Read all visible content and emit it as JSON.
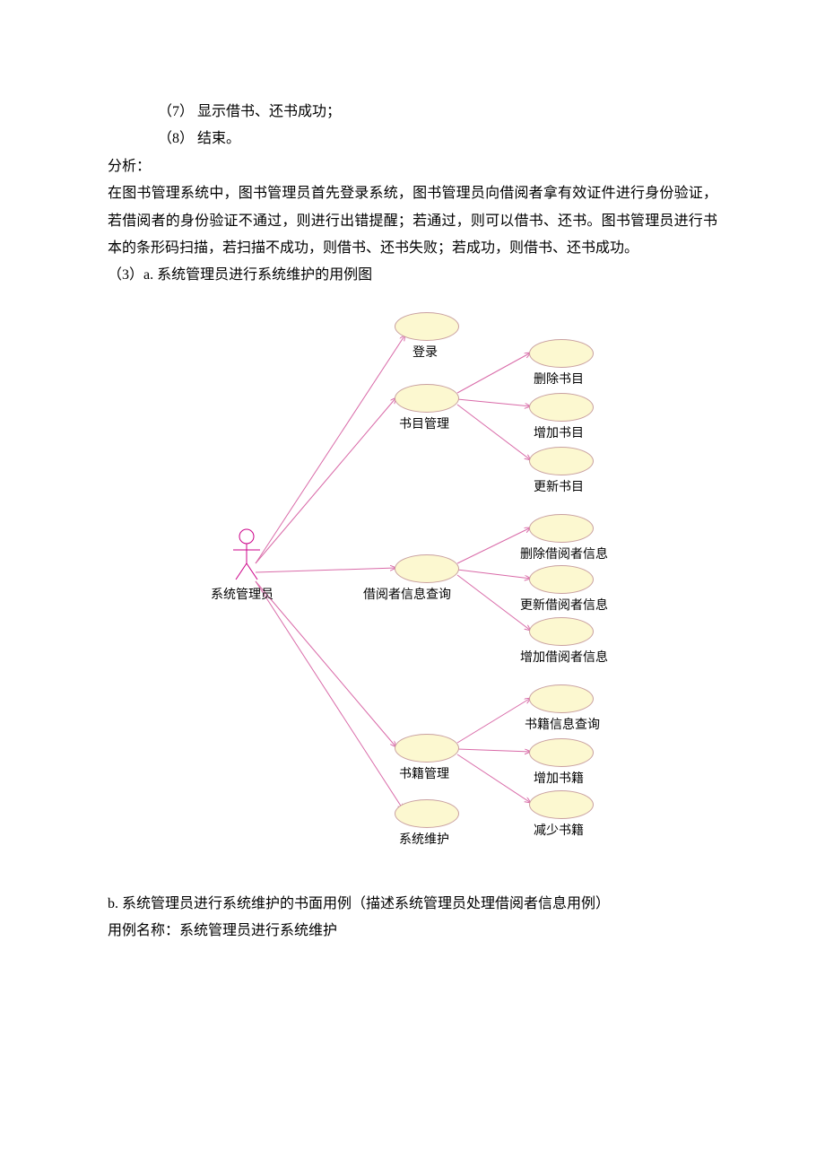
{
  "steps": {
    "s7": "（7）  显示借书、还书成功；",
    "s8": "（8）  结束。"
  },
  "analysis_label": "分析：",
  "analysis_body": "在图书管理系统中，图书管理员首先登录系统，图书管理员向借阅者拿有效证件进行身份验证，若借阅者的身份验证不通过，则进行出错提醒；若通过，则可以借书、还书。图书管理员进行书本的条形码扫描，若扫描不成功，则借书、还书失败；若成功，则借书、还书成功。",
  "section3a": "（3）a.  系统管理员进行系统维护的用例图",
  "actor_label": "系统管理员",
  "usecases": {
    "login": "登录",
    "catalog_mgmt": "书目管理",
    "delete_catalog": "删除书目",
    "add_catalog": "增加书目",
    "update_catalog": "更新书目",
    "reader_query": "借阅者信息查询",
    "delete_reader": "删除借阅者信息",
    "update_reader": "更新借阅者信息",
    "add_reader": "增加借阅者信息",
    "book_mgmt": "书籍管理",
    "book_query": "书籍信息查询",
    "add_book": "增加书籍",
    "reduce_book": "减少书籍",
    "sys_maint": "系统维护"
  },
  "section_b": "b.  系统管理员进行系统维护的书面用例（描述系统管理员处理借阅者信息用例）",
  "usecase_name": "用例名称：系统管理员进行系统维护",
  "chart_data": {
    "type": "uml-use-case",
    "actors": [
      "系统管理员"
    ],
    "use_cases": [
      "登录",
      "书目管理",
      "删除书目",
      "增加书目",
      "更新书目",
      "借阅者信息查询",
      "删除借阅者信息",
      "更新借阅者信息",
      "增加借阅者信息",
      "书籍管理",
      "书籍信息查询",
      "增加书籍",
      "减少书籍",
      "系统维护"
    ],
    "associations": [
      [
        "系统管理员",
        "登录"
      ],
      [
        "系统管理员",
        "书目管理"
      ],
      [
        "系统管理员",
        "借阅者信息查询"
      ],
      [
        "系统管理员",
        "书籍管理"
      ],
      [
        "系统管理员",
        "系统维护"
      ],
      [
        "书目管理",
        "删除书目"
      ],
      [
        "书目管理",
        "增加书目"
      ],
      [
        "书目管理",
        "更新书目"
      ],
      [
        "借阅者信息查询",
        "删除借阅者信息"
      ],
      [
        "借阅者信息查询",
        "更新借阅者信息"
      ],
      [
        "借阅者信息查询",
        "增加借阅者信息"
      ],
      [
        "书籍管理",
        "书籍信息查询"
      ],
      [
        "书籍管理",
        "增加书籍"
      ],
      [
        "书籍管理",
        "减少书籍"
      ]
    ]
  }
}
